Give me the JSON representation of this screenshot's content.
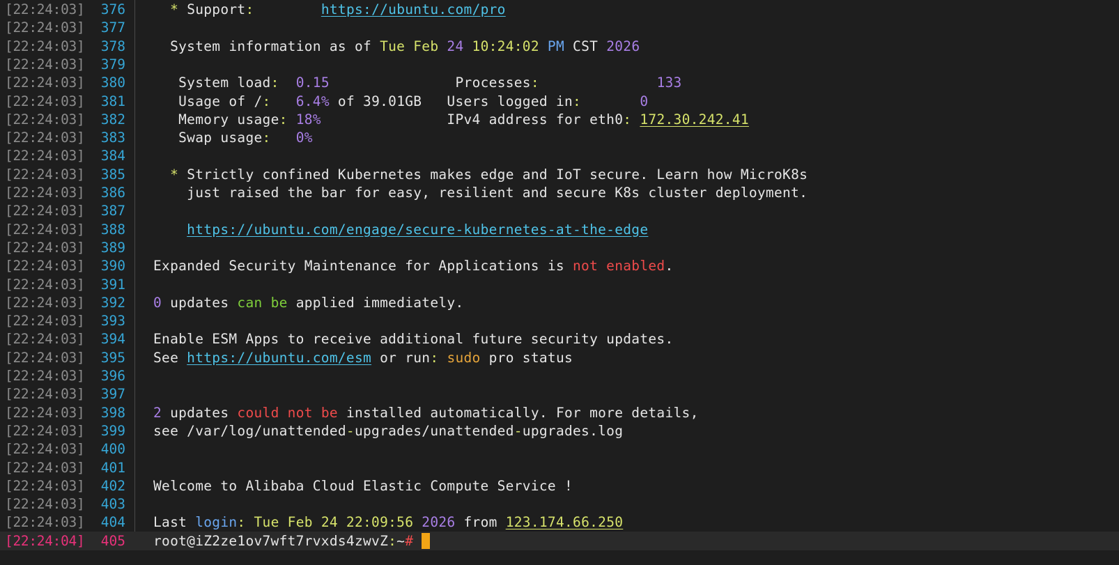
{
  "terminal": {
    "colors": {
      "background": "#1e1e1e",
      "timestamp": "#8c8c8c",
      "line_number": "#36a6d6",
      "current_marker": "#e8317a",
      "cursor": "#f2a516"
    },
    "cursor": "block-cursor",
    "lines": [
      {
        "ts": "[22:24:03]",
        "n": "376",
        "indent": "  ",
        "segs": [
          {
            "t": "* ",
            "c": "yellow"
          },
          {
            "t": "Support",
            "c": "white"
          },
          {
            "t": ":",
            "c": "yellow"
          },
          {
            "t": "        ",
            "c": "white"
          },
          {
            "t": "https://ubuntu.com/pro",
            "c": "cyan",
            "link": true
          }
        ]
      },
      {
        "ts": "[22:24:03]",
        "n": "377",
        "indent": "",
        "segs": []
      },
      {
        "ts": "[22:24:03]",
        "n": "378",
        "indent": "  ",
        "segs": [
          {
            "t": "System information as of ",
            "c": "white"
          },
          {
            "t": "Tue Feb ",
            "c": "yellow"
          },
          {
            "t": "24",
            "c": "purple"
          },
          {
            "t": " 10:24:02 ",
            "c": "yellow"
          },
          {
            "t": "PM",
            "c": "blue"
          },
          {
            "t": " CST ",
            "c": "white"
          },
          {
            "t": "2026",
            "c": "purple"
          }
        ]
      },
      {
        "ts": "[22:24:03]",
        "n": "379",
        "indent": "",
        "segs": []
      },
      {
        "ts": "[22:24:03]",
        "n": "380",
        "indent": "   ",
        "segs": [
          {
            "t": "System load",
            "c": "white"
          },
          {
            "t": ":",
            "c": "yellow"
          },
          {
            "t": "  ",
            "c": "white"
          },
          {
            "t": "0.15",
            "c": "purple"
          },
          {
            "t": "               Processes",
            "c": "white"
          },
          {
            "t": ":",
            "c": "yellow"
          },
          {
            "t": "              ",
            "c": "white"
          },
          {
            "t": "133",
            "c": "purple"
          }
        ]
      },
      {
        "ts": "[22:24:03]",
        "n": "381",
        "indent": "   ",
        "segs": [
          {
            "t": "Usage of /",
            "c": "white"
          },
          {
            "t": ":",
            "c": "yellow"
          },
          {
            "t": "   ",
            "c": "white"
          },
          {
            "t": "6.4%",
            "c": "purple"
          },
          {
            "t": " of 39.01GB   Users logged in",
            "c": "white"
          },
          {
            "t": ":",
            "c": "yellow"
          },
          {
            "t": "       ",
            "c": "white"
          },
          {
            "t": "0",
            "c": "purple"
          }
        ]
      },
      {
        "ts": "[22:24:03]",
        "n": "382",
        "indent": "   ",
        "segs": [
          {
            "t": "Memory usage",
            "c": "white"
          },
          {
            "t": ":",
            "c": "yellow"
          },
          {
            "t": " ",
            "c": "white"
          },
          {
            "t": "18%",
            "c": "purple"
          },
          {
            "t": "               IPv4 address for eth0",
            "c": "white"
          },
          {
            "t": ":",
            "c": "yellow"
          },
          {
            "t": " ",
            "c": "white"
          },
          {
            "t": "172.30.242.41",
            "c": "yellow",
            "link": true
          }
        ]
      },
      {
        "ts": "[22:24:03]",
        "n": "383",
        "indent": "   ",
        "segs": [
          {
            "t": "Swap usage",
            "c": "white"
          },
          {
            "t": ":",
            "c": "yellow"
          },
          {
            "t": "   ",
            "c": "white"
          },
          {
            "t": "0%",
            "c": "purple"
          }
        ]
      },
      {
        "ts": "[22:24:03]",
        "n": "384",
        "indent": "",
        "segs": []
      },
      {
        "ts": "[22:24:03]",
        "n": "385",
        "indent": "  ",
        "segs": [
          {
            "t": "* ",
            "c": "yellow"
          },
          {
            "t": "Strictly confined Kubernetes makes edge and IoT secure. Learn how MicroK8s",
            "c": "white"
          }
        ]
      },
      {
        "ts": "[22:24:03]",
        "n": "386",
        "indent": "    ",
        "segs": [
          {
            "t": "just raised the bar for easy, resilient and secure K8s cluster deployment.",
            "c": "white"
          }
        ]
      },
      {
        "ts": "[22:24:03]",
        "n": "387",
        "indent": "",
        "segs": []
      },
      {
        "ts": "[22:24:03]",
        "n": "388",
        "indent": "    ",
        "segs": [
          {
            "t": "https://ubuntu.com/engage/secure-kubernetes-at-the-edge",
            "c": "cyan",
            "link": true
          }
        ]
      },
      {
        "ts": "[22:24:03]",
        "n": "389",
        "indent": "",
        "segs": []
      },
      {
        "ts": "[22:24:03]",
        "n": "390",
        "indent": "",
        "segs": [
          {
            "t": "Expanded Security Maintenance for Applications is ",
            "c": "white"
          },
          {
            "t": "not enabled",
            "c": "red"
          },
          {
            "t": ".",
            "c": "white"
          }
        ]
      },
      {
        "ts": "[22:24:03]",
        "n": "391",
        "indent": "",
        "segs": []
      },
      {
        "ts": "[22:24:03]",
        "n": "392",
        "indent": "",
        "segs": [
          {
            "t": "0",
            "c": "purple"
          },
          {
            "t": " updates ",
            "c": "white"
          },
          {
            "t": "can be",
            "c": "green"
          },
          {
            "t": " applied immediately.",
            "c": "white"
          }
        ]
      },
      {
        "ts": "[22:24:03]",
        "n": "393",
        "indent": "",
        "segs": []
      },
      {
        "ts": "[22:24:03]",
        "n": "394",
        "indent": "",
        "segs": [
          {
            "t": "Enable ESM Apps to receive additional future security updates.",
            "c": "white"
          }
        ]
      },
      {
        "ts": "[22:24:03]",
        "n": "395",
        "indent": "",
        "segs": [
          {
            "t": "See ",
            "c": "white"
          },
          {
            "t": "https://ubuntu.com/esm",
            "c": "cyan",
            "link": true
          },
          {
            "t": " or run",
            "c": "white"
          },
          {
            "t": ":",
            "c": "yellow"
          },
          {
            "t": " ",
            "c": "white"
          },
          {
            "t": "sudo",
            "c": "orange"
          },
          {
            "t": " pro status",
            "c": "white"
          }
        ]
      },
      {
        "ts": "[22:24:03]",
        "n": "396",
        "indent": "",
        "segs": []
      },
      {
        "ts": "[22:24:03]",
        "n": "397",
        "indent": "",
        "segs": []
      },
      {
        "ts": "[22:24:03]",
        "n": "398",
        "indent": "",
        "segs": [
          {
            "t": "2",
            "c": "purple"
          },
          {
            "t": " updates ",
            "c": "white"
          },
          {
            "t": "could not be",
            "c": "red"
          },
          {
            "t": " installed automatically. For more details,",
            "c": "white"
          }
        ]
      },
      {
        "ts": "[22:24:03]",
        "n": "399",
        "indent": "",
        "segs": [
          {
            "t": "see /var/log/unattended",
            "c": "white"
          },
          {
            "t": "-",
            "c": "yellow"
          },
          {
            "t": "upgrades/unattended",
            "c": "white"
          },
          {
            "t": "-",
            "c": "yellow"
          },
          {
            "t": "upgrades.log",
            "c": "white"
          }
        ]
      },
      {
        "ts": "[22:24:03]",
        "n": "400",
        "indent": "",
        "segs": []
      },
      {
        "ts": "[22:24:03]",
        "n": "401",
        "indent": "",
        "segs": []
      },
      {
        "ts": "[22:24:03]",
        "n": "402",
        "indent": "",
        "segs": [
          {
            "t": "Welcome to Alibaba Cloud Elastic Compute Service !",
            "c": "white"
          }
        ]
      },
      {
        "ts": "[22:24:03]",
        "n": "403",
        "indent": "",
        "segs": []
      },
      {
        "ts": "[22:24:03]",
        "n": "404",
        "indent": "",
        "segs": [
          {
            "t": "Last ",
            "c": "white"
          },
          {
            "t": "login",
            "c": "blue"
          },
          {
            "t": ":",
            "c": "yellow"
          },
          {
            "t": " Tue Feb 24 22:09:56 ",
            "c": "yellow"
          },
          {
            "t": "2026",
            "c": "purple"
          },
          {
            "t": " from ",
            "c": "white"
          },
          {
            "t": "123.174.66.250",
            "c": "yellow",
            "link": true
          }
        ]
      },
      {
        "ts": "[22:24:04]",
        "n": "405",
        "indent": "",
        "current": true,
        "segs": [
          {
            "t": "root@iZ2ze1ov7wft7rvxds4zwvZ",
            "c": "white"
          },
          {
            "t": ":",
            "c": "yellow"
          },
          {
            "t": "~",
            "c": "white"
          },
          {
            "t": "#",
            "c": "red"
          },
          {
            "t": " ",
            "c": "white"
          }
        ]
      }
    ]
  }
}
